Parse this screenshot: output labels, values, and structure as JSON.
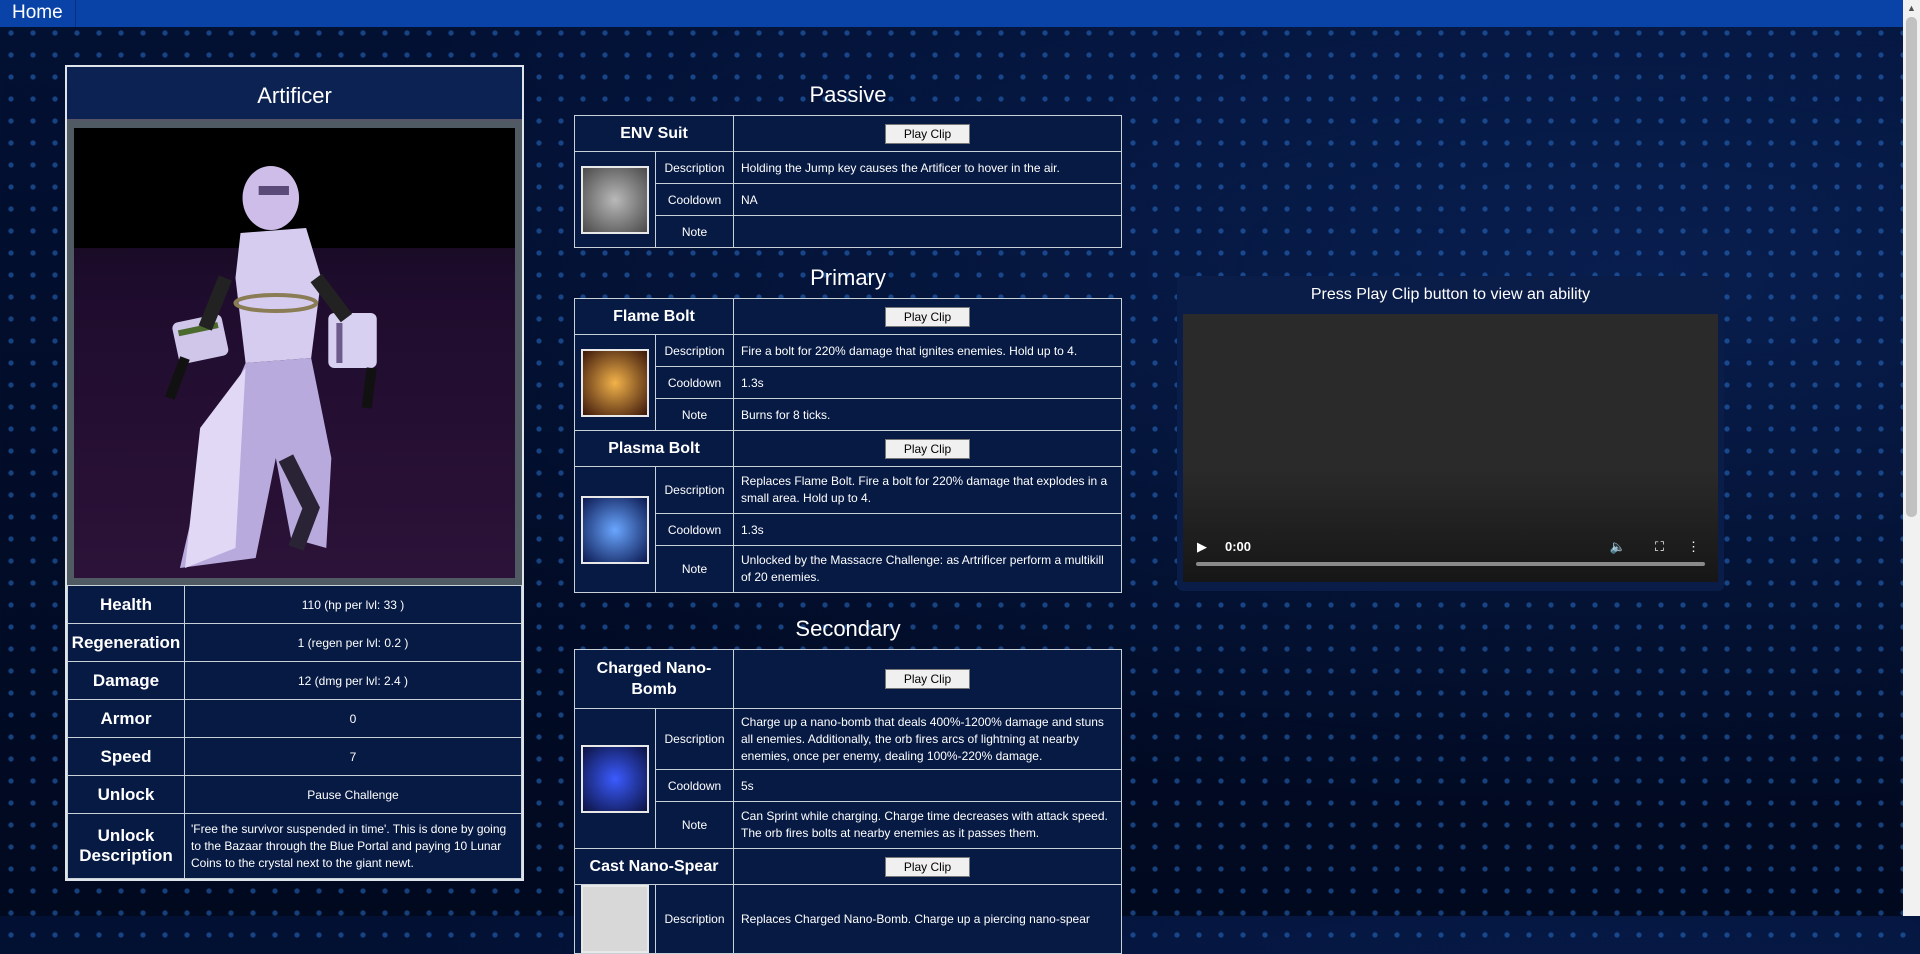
{
  "nav": {
    "home_label": "Home"
  },
  "character": {
    "name": "Artificer",
    "stats": [
      {
        "label": "Health",
        "value": "110 (hp per lvl: 33 )"
      },
      {
        "label": "Regeneration",
        "value": "1 (regen per lvl: 0.2 )"
      },
      {
        "label": "Damage",
        "value": "12 (dmg per lvl: 2.4 )"
      },
      {
        "label": "Armor",
        "value": "0"
      },
      {
        "label": "Speed",
        "value": "7"
      },
      {
        "label": "Unlock",
        "value": "Pause Challenge"
      },
      {
        "label": "Unlock Description",
        "value": "'Free the survivor suspended in time'. This is done by going to the Bazaar through the Blue Portal and paying 10 Lunar Coins to the crystal next to the giant newt."
      }
    ]
  },
  "labels": {
    "description": "Description",
    "cooldown": "Cooldown",
    "note": "Note",
    "play": "Play Clip"
  },
  "sections": {
    "passive": "Passive",
    "primary": "Primary",
    "secondary": "Secondary"
  },
  "abilities": {
    "env_suit": {
      "name": "ENV Suit",
      "description": "Holding the Jump key causes the Artificer to hover in the air.",
      "cooldown": "NA",
      "note": ""
    },
    "flame_bolt": {
      "name": "Flame Bolt",
      "description": "Fire a bolt for 220% damage that ignites enemies. Hold up to 4.",
      "cooldown": "1.3s",
      "note": "Burns for 8 ticks."
    },
    "plasma_bolt": {
      "name": "Plasma Bolt",
      "description": "Replaces Flame Bolt. Fire a bolt for 220% damage that explodes in a small area. Hold up to 4.",
      "cooldown": "1.3s",
      "note": "Unlocked by the Massacre Challenge: as Artrificer perform a multikill of 20 enemies."
    },
    "nano_bomb": {
      "name": "Charged Nano-Bomb",
      "description": "Charge up a nano-bomb that deals 400%-1200% damage and stuns all enemies. Additionally, the orb fires arcs of lightning at nearby enemies, once per enemy, dealing 100%-220% damage.",
      "cooldown": "5s",
      "note": "Can Sprint while charging. Charge time decreases with attack speed. The orb fires bolts at nearby enemies as it passes them."
    },
    "nano_spear": {
      "name": "Cast Nano-Spear",
      "description": "Replaces Charged Nano-Bomb. Charge up a piercing nano-spear"
    }
  },
  "video": {
    "title": "Press Play Clip button to view an ability",
    "time": "0:00"
  }
}
